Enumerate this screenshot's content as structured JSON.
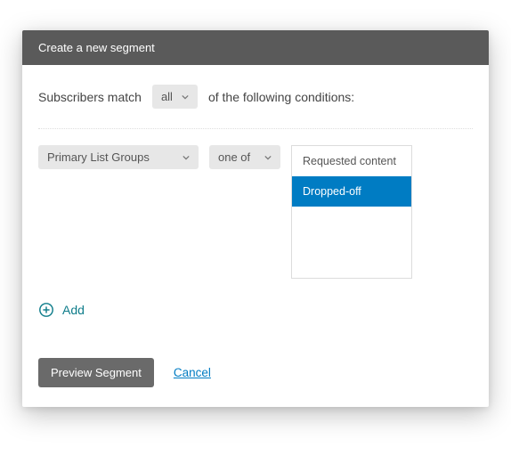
{
  "header": {
    "title": "Create a new segment"
  },
  "match": {
    "prefix": "Subscribers match",
    "dropdown_value": "all",
    "suffix": "of the following conditions:"
  },
  "condition": {
    "field_select": "Primary List Groups",
    "operator_select": "one of",
    "options": [
      {
        "label": "Requested content",
        "selected": false
      },
      {
        "label": "Dropped-off",
        "selected": true
      }
    ]
  },
  "actions": {
    "add_label": "Add",
    "preview_label": "Preview Segment",
    "cancel_label": "Cancel"
  },
  "icons": {
    "chevron": "chevron-down-icon",
    "plus": "plus-circle-icon"
  }
}
